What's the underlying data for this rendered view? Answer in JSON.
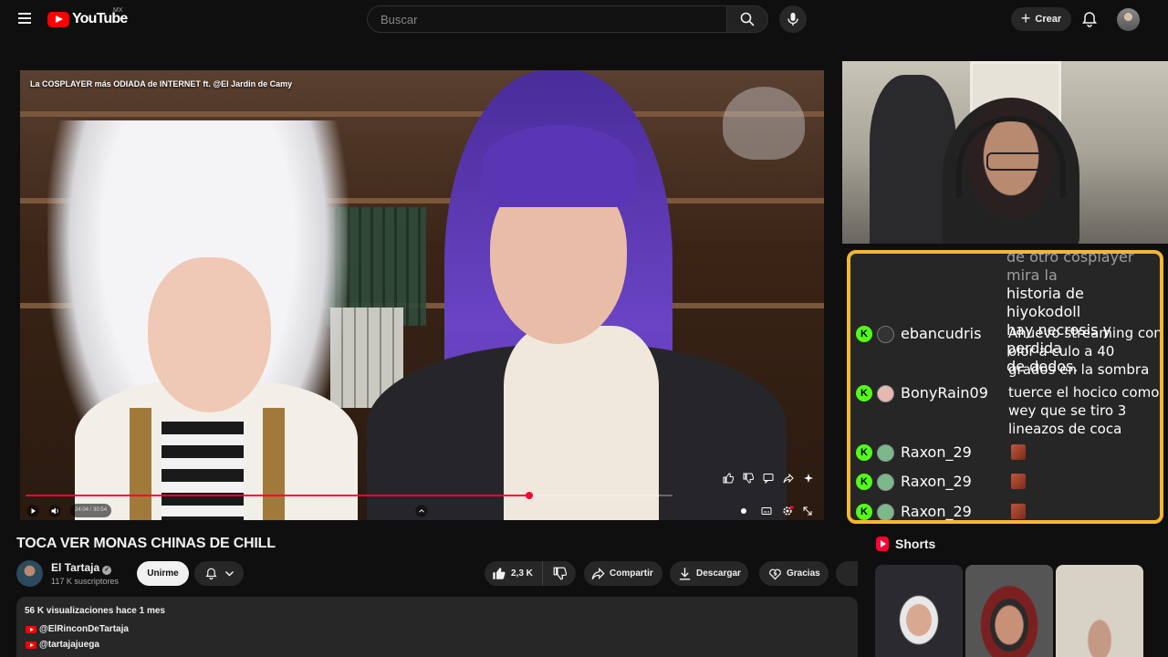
{
  "header": {
    "logo_text": "YouTube",
    "country_code": "MX",
    "search_placeholder": "Buscar",
    "create_label": "Crear"
  },
  "player": {
    "overlay_title": "La COSPLAYER más ODIADA de INTERNET ft. @El Jardin de Camy",
    "time_display": "24:04 / 30:54",
    "progress": 0.779
  },
  "chat": {
    "partial_message_lines": [
      "de otro cosplayer mira la",
      "historia de hiyokodoll",
      "hay necrosis y perdida",
      "de dedos."
    ],
    "messages": [
      {
        "user": "ebancudris",
        "text": "Ahuevo streaming con olor a culo a 40 grados en la sombra"
      },
      {
        "user": "BonyRain09",
        "text": "tuerce el hocico como wey que se tiro 3 lineazos de coca"
      },
      {
        "user": "Raxon_29",
        "text": ""
      },
      {
        "user": "Raxon_29",
        "text": ""
      },
      {
        "user": "Raxon_29",
        "text": ""
      }
    ],
    "badge_letter": "K",
    "border_color": "#f5b731"
  },
  "video": {
    "title": "TOCA VER MONAS CHINAS DE CHILL",
    "channel_name": "El Tartaja",
    "subscribers": "117 K suscriptores",
    "join_label": "Unirme",
    "likes": "2,3 K",
    "share_label": "Compartir",
    "download_label": "Descargar",
    "thanks_label": "Gracias"
  },
  "description": {
    "meta": "56 K visualizaciones  hace 1 mes",
    "links": [
      "@ElRinconDeTartaja",
      "@tartajajuega"
    ]
  },
  "shorts": {
    "title": "Shorts"
  }
}
